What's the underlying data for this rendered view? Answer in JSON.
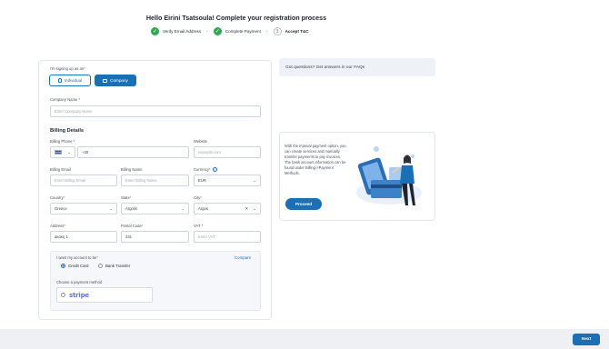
{
  "title": "Hello Eirini Tsatsoula! Complete your registration process",
  "steps": [
    {
      "label": "Verify Email Address",
      "status": "done"
    },
    {
      "label": "Complete Payment",
      "status": "done"
    },
    {
      "number": "3",
      "label": "Accept T&C",
      "status": "current"
    }
  ],
  "form": {
    "signing_up_label": "I'm signing up as an",
    "individual_label": "Individual",
    "company_label": "Company",
    "company_name_label": "Company Name",
    "company_name_placeholder": "Enter Company Name",
    "billing_details_title": "Billing Details",
    "billing_phone_label": "Billing Phone",
    "phone_country_code": "+30",
    "website_label": "Website",
    "website_placeholder": "example.com",
    "billing_email_label": "Billing Email",
    "billing_email_placeholder": "Enter Billing Email",
    "billing_name_label": "Billing Name",
    "billing_name_placeholder": "Enter Billing Name",
    "currency_label": "Currency",
    "currency_value": "EUR",
    "country_label": "Country",
    "country_value": "Greece",
    "state_label": "State",
    "state_value": "Argolis",
    "city_label": "City",
    "city_value": "Argos",
    "address_label": "Address",
    "address_value": "ακακη 1",
    "postal_code_label": "Postal Code",
    "postal_code_value": "331",
    "vat_label": "VAT",
    "vat_placeholder": "Enter VAT",
    "account_box_label": "I want my account to be",
    "compare_link": "Compare",
    "credit_card_label": "Credit Card",
    "bank_transfer_label": "Bank Transfer",
    "payment_method_label": "Choose a payment method",
    "stripe_label": "stripe"
  },
  "sidebar": {
    "faq_text": "Got questions? Get answers in our FAQs",
    "promo_text": "With the manual payment option, you can create services and manually transfer payments to pay invoices. The bank account information can be found under Billing->Payment Methods.",
    "proceed_label": "Proceed"
  },
  "footer": {
    "next_label": "Next"
  },
  "colors": {
    "primary": "#1b6fb5",
    "success": "#2fa84f",
    "stripe": "#6772e5"
  }
}
